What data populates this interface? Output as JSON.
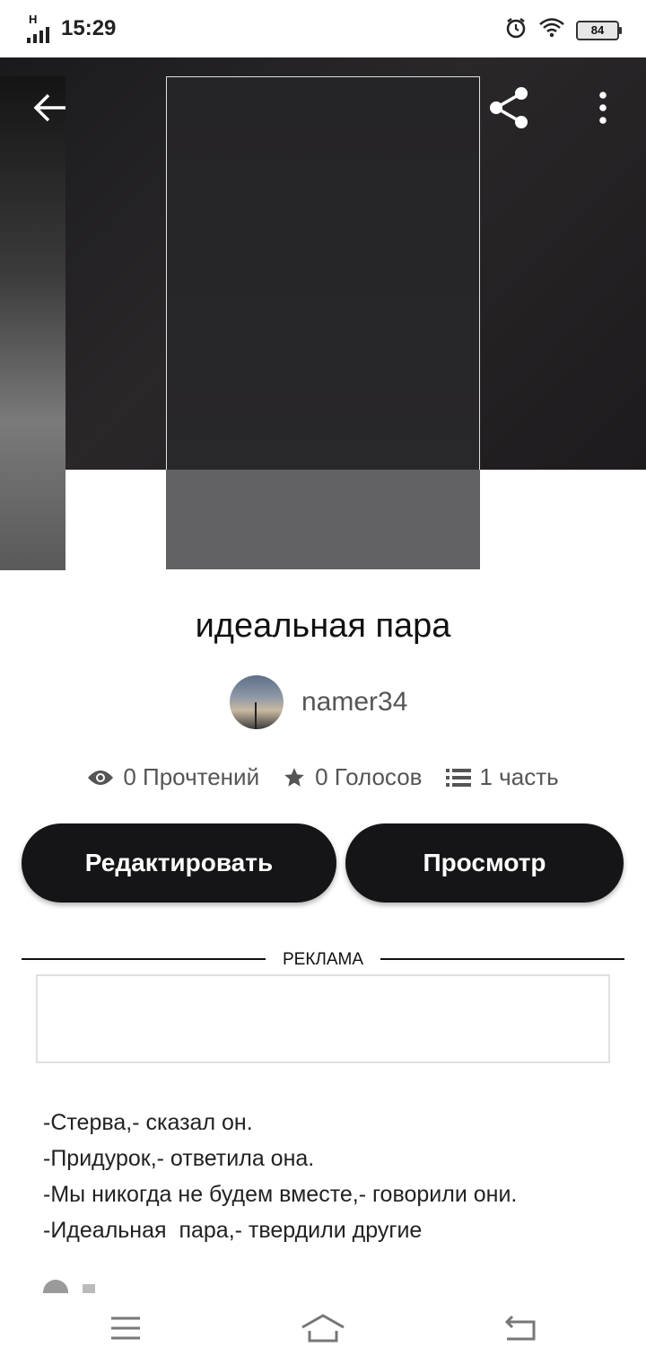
{
  "status_bar": {
    "network_type": "H",
    "time": "15:29",
    "battery_level": "84",
    "icons": [
      "alarm-icon",
      "wifi-icon",
      "battery-icon"
    ]
  },
  "header": {
    "back_icon": "arrow-left-icon",
    "share_icon": "share-icon",
    "more_icon": "more-vert-icon"
  },
  "story": {
    "title": "идеальная пара",
    "author": "namer34",
    "stats": {
      "reads": "0 Прочтений",
      "votes": "0 Голосов",
      "parts": "1 часть"
    },
    "buttons": {
      "edit": "Редактировать",
      "view": "Просмотр"
    },
    "ad_label": "РЕКЛАМА",
    "description": [
      "-Стерва,- сказал он.",
      "-Придурок,- ответила она.",
      "-Мы никогда не будем вместе,- говорили они.",
      "-Идеальная  пара,- твердили другие"
    ]
  },
  "nav_bar": {
    "icons": [
      "menu-icon",
      "home-icon",
      "back-icon"
    ]
  }
}
